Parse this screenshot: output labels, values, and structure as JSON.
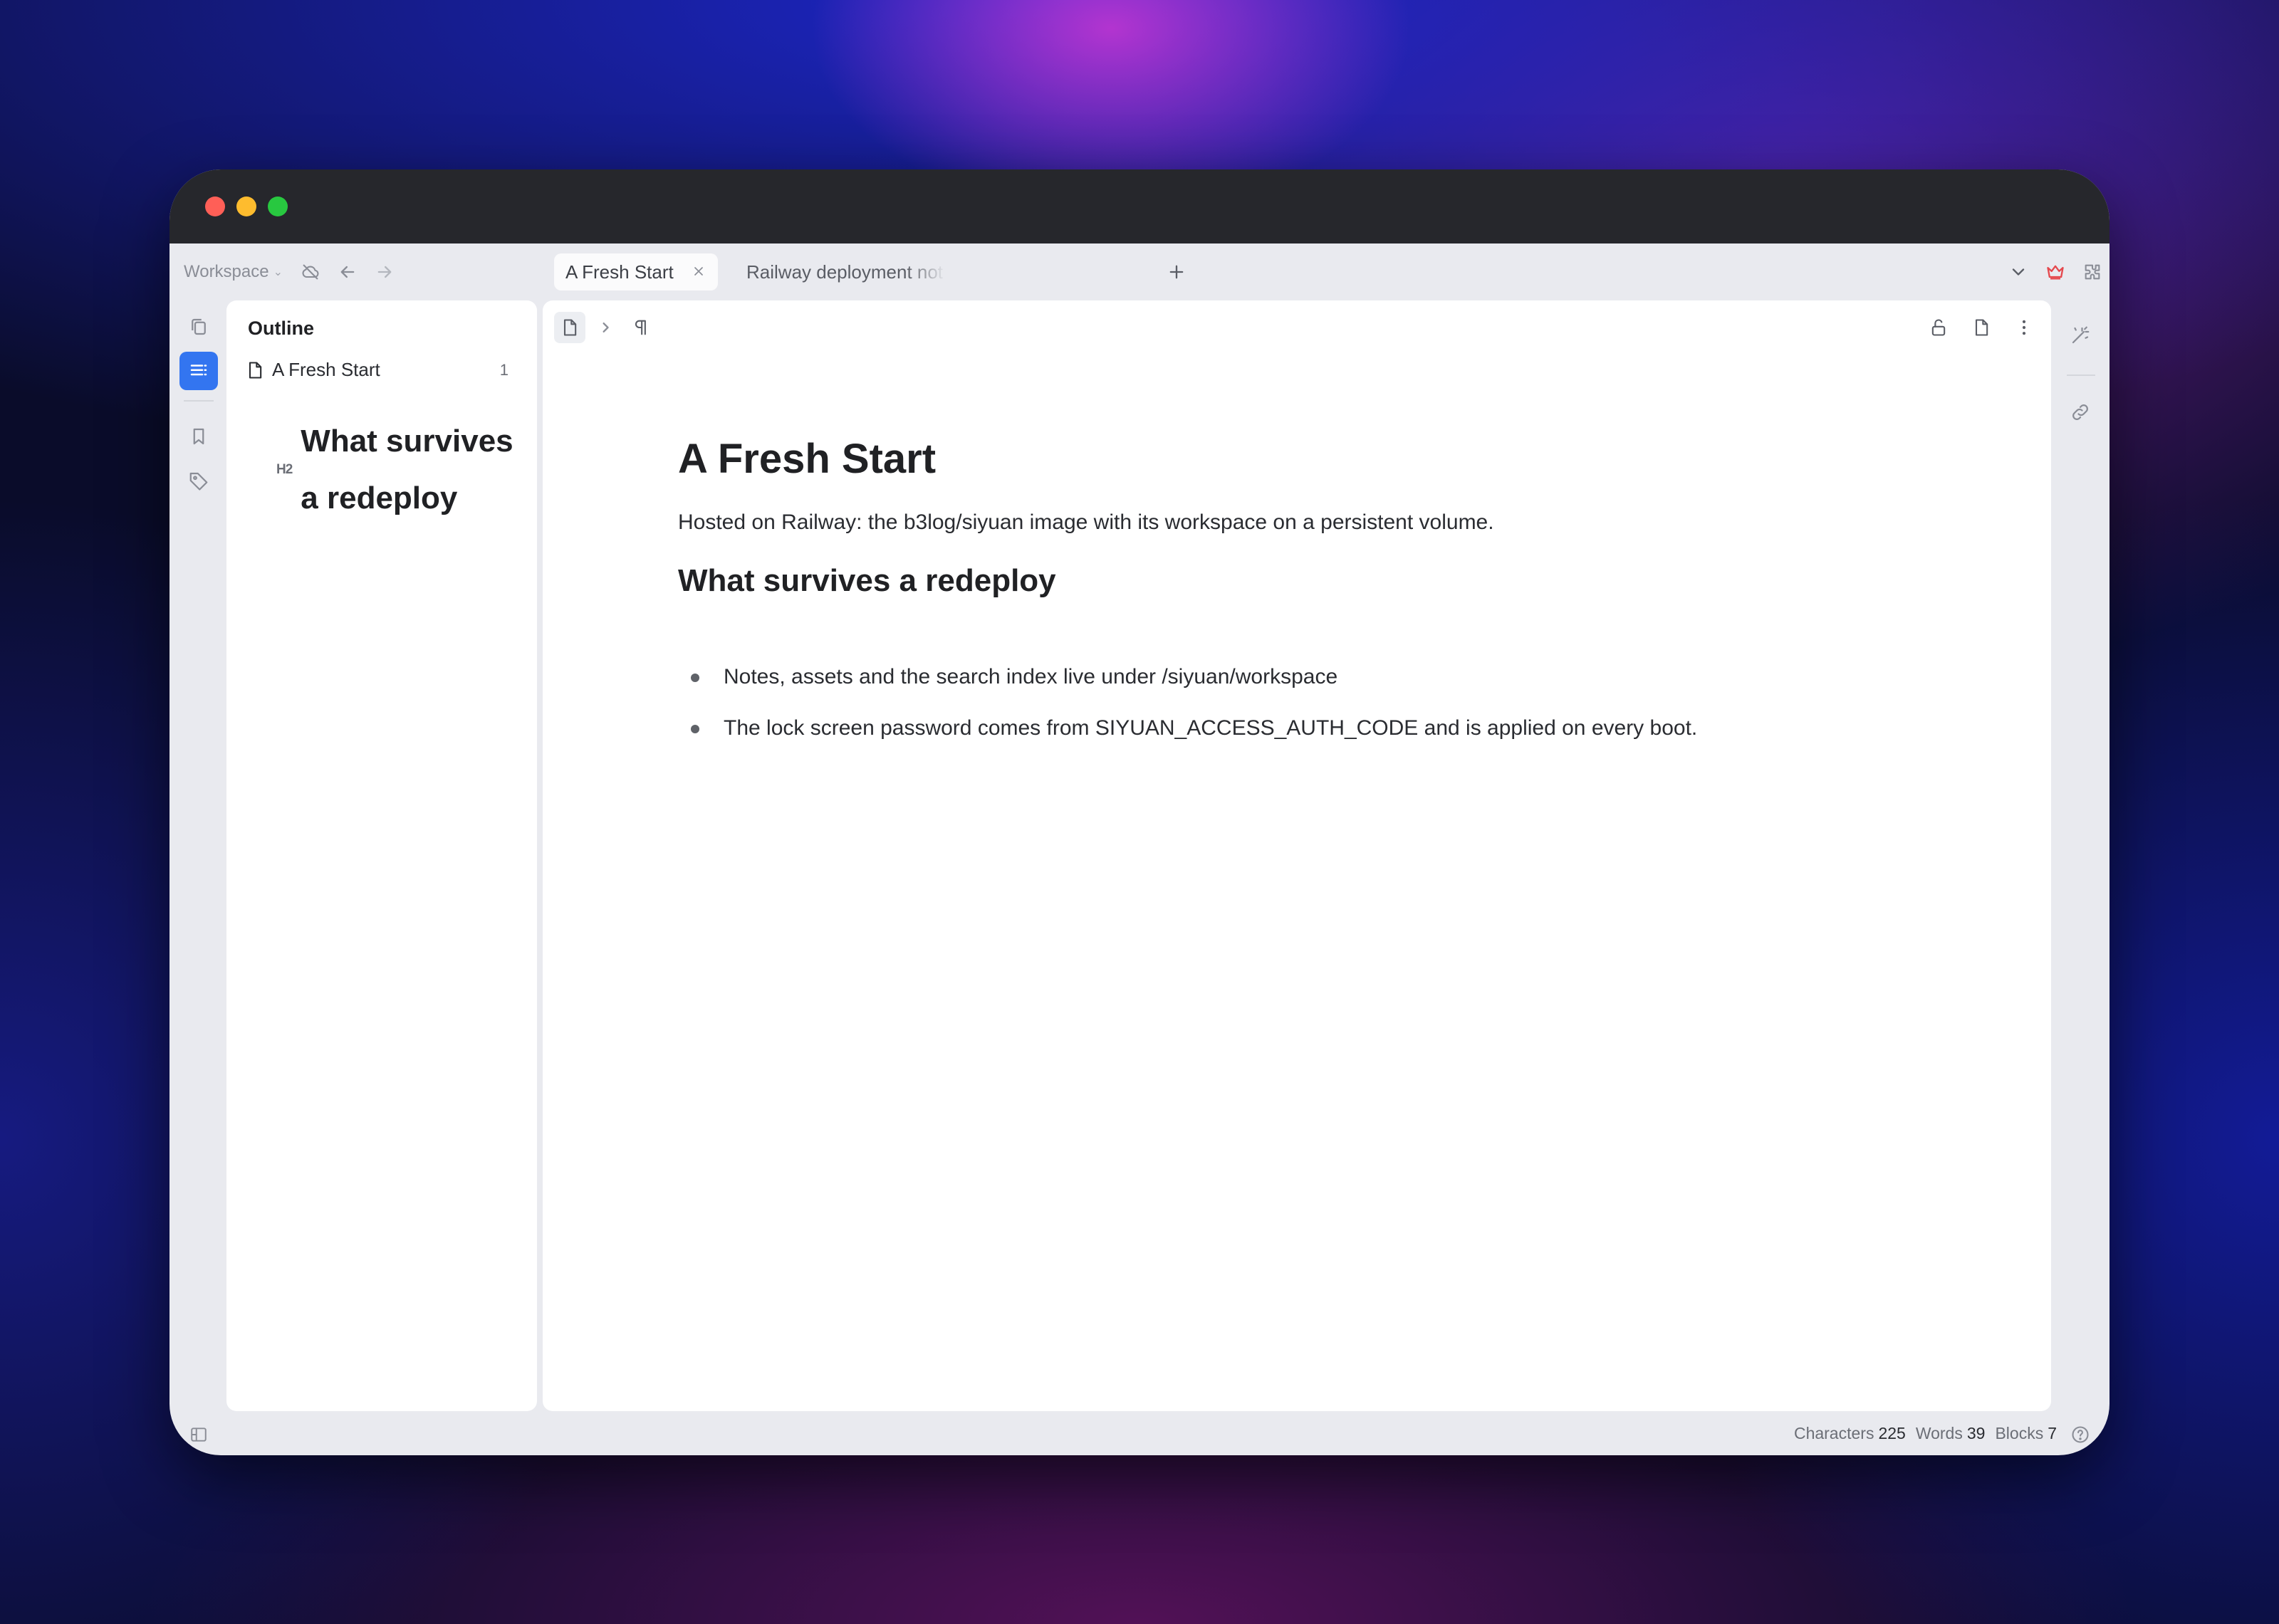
{
  "toolbar": {
    "workspace_label": "Workspace",
    "tabs": [
      {
        "label": "A Fresh Start",
        "active": true
      },
      {
        "label": "Railway deployment not",
        "active": false
      }
    ],
    "new_tab_label": "+"
  },
  "outline": {
    "title": "Outline",
    "doc_title": "A Fresh Start",
    "doc_count": "1",
    "heading_level": "H2",
    "heading": "What survives a redeploy"
  },
  "document": {
    "title": "A Fresh Start",
    "paragraph": "Hosted on Railway: the b3log/siyuan image with its workspace on a persistent volume.",
    "heading": "What survives a redeploy",
    "bullets": [
      "Notes, assets and the search index live under /siyuan/workspace",
      "The lock screen password comes from SIYUAN_ACCESS_AUTH_CODE and is applied on every boot."
    ]
  },
  "statusbar": {
    "characters_label": "Characters",
    "characters": "225",
    "words_label": "Words",
    "words": "39",
    "blocks_label": "Blocks",
    "blocks": "7"
  },
  "colors": {
    "accent": "#3375f0",
    "crown": "#e5484d",
    "traffic_red": "#ff5f57",
    "traffic_yellow": "#febc2e",
    "traffic_green": "#28c840"
  },
  "icons": [
    "sync-off-icon",
    "arrow-left-icon",
    "arrow-right-icon",
    "close-icon",
    "plus-icon",
    "chevron-down-icon",
    "crown-icon",
    "plugin-icon",
    "layout-icon",
    "search-icon",
    "theme-icon",
    "more-vertical-icon",
    "files-icon",
    "outline-icon",
    "bookmark-icon",
    "tag-icon",
    "document-icon",
    "chevron-right-icon",
    "paragraph-icon",
    "unlock-icon",
    "magic-wand-icon",
    "link-icon",
    "panel-icon",
    "help-icon"
  ]
}
